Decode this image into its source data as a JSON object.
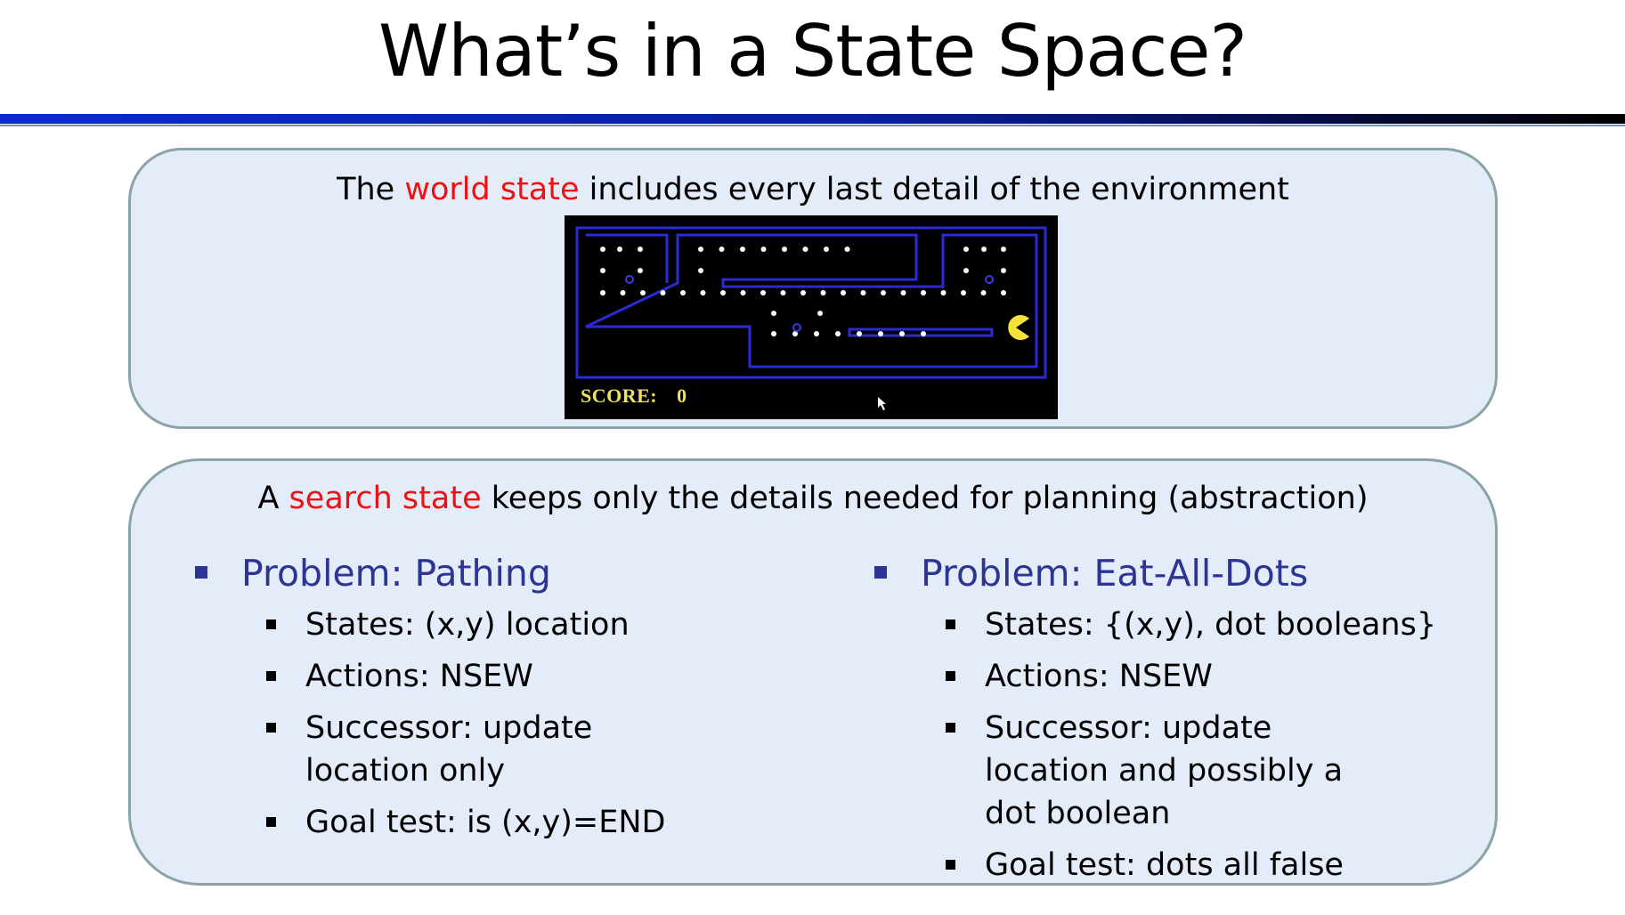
{
  "slide": {
    "title": "What’s in a State Space?"
  },
  "world_box": {
    "caption_pre": "The ",
    "caption_highlight": "world state",
    "caption_post": " includes every last detail of the environment",
    "game": {
      "score_label": "SCORE:",
      "score_value": "0"
    }
  },
  "search_box": {
    "caption_pre": "A ",
    "caption_highlight": "search state",
    "caption_post": " keeps only the details needed for planning (abstraction)",
    "problems": [
      {
        "heading": "Problem: Pathing",
        "items": [
          "States: (x,y) location",
          "Actions: NSEW",
          "Successor: update location only",
          "Goal test: is (x,y)=END"
        ]
      },
      {
        "heading": "Problem: Eat-All-Dots",
        "items": [
          "States: {(x,y), dot booleans}",
          "Actions: NSEW",
          "Successor: update location and possibly a dot boolean",
          "Goal test: dots all false"
        ]
      }
    ]
  },
  "colors": {
    "highlight": "#ee1111",
    "heading": "#2c3592",
    "box_fill": "#e4ebf9",
    "box_border": "#8aa3a6",
    "maze_wall": "#2b2bd6",
    "pacman": "#f5e23a",
    "score": "#f0e060"
  }
}
